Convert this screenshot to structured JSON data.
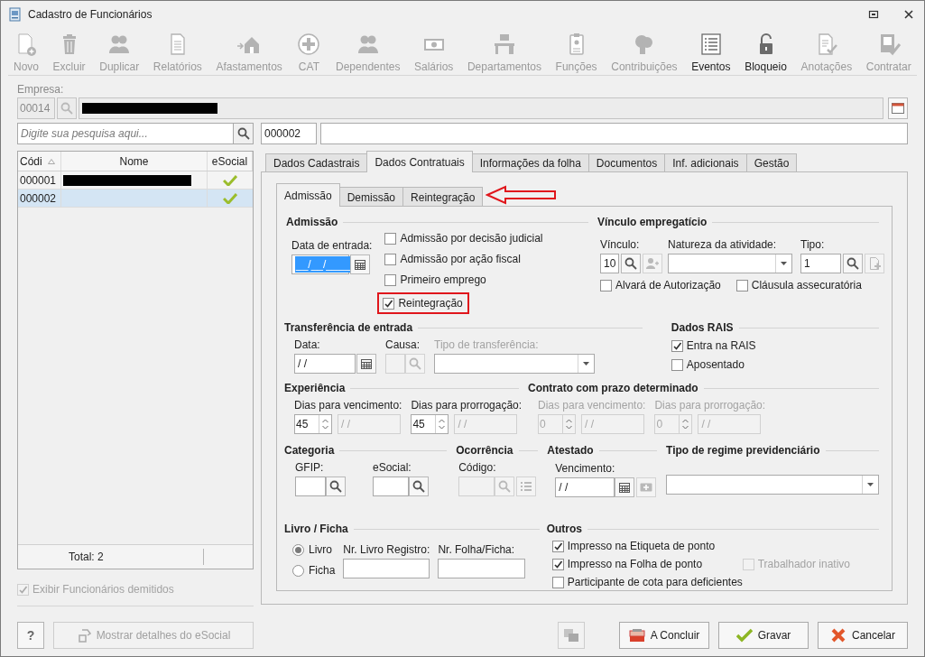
{
  "window": {
    "title": "Cadastro de Funcionários"
  },
  "toolbar": [
    {
      "label": "Novo",
      "enabled": false
    },
    {
      "label": "Excluir",
      "enabled": false
    },
    {
      "label": "Duplicar",
      "enabled": false
    },
    {
      "label": "Relatórios",
      "enabled": false
    },
    {
      "label": "Afastamentos",
      "enabled": false
    },
    {
      "label": "CAT",
      "enabled": false
    },
    {
      "label": "Dependentes",
      "enabled": false
    },
    {
      "label": "Salários",
      "enabled": false
    },
    {
      "label": "Departamentos",
      "enabled": false
    },
    {
      "label": "Funções",
      "enabled": false
    },
    {
      "label": "Contribuições",
      "enabled": false
    },
    {
      "label": "Eventos",
      "enabled": true
    },
    {
      "label": "Bloqueio",
      "enabled": true
    },
    {
      "label": "Anotações",
      "enabled": false
    },
    {
      "label": "Contratar",
      "enabled": false
    }
  ],
  "empresa": {
    "label": "Empresa:",
    "code": "00014"
  },
  "search": {
    "placeholder": "Digite sua pesquisa aqui..."
  },
  "employee_code": "000002",
  "table": {
    "columns": [
      {
        "label": "Códi",
        "sorted": true
      },
      {
        "label": "Nome",
        "sorted": false
      },
      {
        "label": "eSocial",
        "sorted": false
      }
    ],
    "rows": [
      {
        "code": "000001",
        "esocial": true,
        "selected": false
      },
      {
        "code": "000002",
        "esocial": true,
        "selected": true
      }
    ],
    "total": "Total: 2"
  },
  "show_dismissed": {
    "label": "Exibir Funcionários demitidos",
    "checked": true,
    "disabled": true
  },
  "tabs": [
    {
      "label": "Dados Cadastrais",
      "selected": false
    },
    {
      "label": "Dados Contratuais",
      "selected": true
    },
    {
      "label": "Informações da folha",
      "selected": false
    },
    {
      "label": "Documentos",
      "selected": false
    },
    {
      "label": "Inf. adicionais",
      "selected": false
    },
    {
      "label": "Gestão",
      "selected": false
    }
  ],
  "subtabs": [
    {
      "label": "Admissão",
      "selected": true,
      "annotated": false
    },
    {
      "label": "Demissão",
      "selected": false,
      "annotated": false
    },
    {
      "label": "Reintegração",
      "selected": false,
      "annotated": true
    }
  ],
  "admissao": {
    "title": "Admissão",
    "date_label": "Data de entrada:",
    "date_value": "__/__/____",
    "date_selected": true,
    "checkboxes": [
      {
        "label": "Admissão por decisão judicial",
        "checked": false,
        "highlighted": false
      },
      {
        "label": "Admissão por ação fiscal",
        "checked": false,
        "highlighted": false
      },
      {
        "label": "Primeiro emprego",
        "checked": false,
        "highlighted": false
      },
      {
        "label": "Reintegração",
        "checked": true,
        "highlighted": true
      }
    ]
  },
  "vinculo": {
    "title": "Vínculo empregatício",
    "vinculo_label": "Vínculo:",
    "vinculo_value": "10",
    "natureza_label": "Natureza da atividade:",
    "tipo_label": "Tipo:",
    "tipo_value": "1",
    "checkboxes": [
      {
        "label": "Alvará de Autorização",
        "checked": false
      },
      {
        "label": "Cláusula assecuratória",
        "checked": false
      }
    ]
  },
  "transferencia": {
    "title": "Transferência de entrada",
    "data_label": "Data:",
    "data_value": "/ /",
    "causa_label": "Causa:",
    "tipo_label": "Tipo de transferência:",
    "causa_disabled": true
  },
  "rais": {
    "title": "Dados RAIS",
    "checkboxes": [
      {
        "label": "Entra na RAIS",
        "checked": true
      },
      {
        "label": "Aposentado",
        "checked": false
      }
    ]
  },
  "experiencia": {
    "title": "Experiência",
    "disabled": false,
    "fields": [
      {
        "label": "Dias para vencimento:",
        "days": "45",
        "date": "/ /"
      },
      {
        "label": "Dias para prorrogação:",
        "days": "45",
        "date": "/ /"
      }
    ]
  },
  "contrato": {
    "title": "Contrato com prazo determinado",
    "disabled": true,
    "fields": [
      {
        "label": "Dias para vencimento:",
        "days": "0",
        "date": "/ /"
      },
      {
        "label": "Dias para prorrogação:",
        "days": "0",
        "date": "/ /"
      }
    ]
  },
  "categoria": {
    "title": "Categoria",
    "gfip_label": "GFIP:",
    "esocial_label": "eSocial:"
  },
  "ocorrencia": {
    "title": "Ocorrência",
    "codigo_label": "Código:",
    "codigo_disabled": true
  },
  "atestado": {
    "title": "Atestado",
    "vencimento_label": "Vencimento:",
    "vencimento_value": "/ /"
  },
  "regime": {
    "title": "Tipo de regime previdenciário"
  },
  "livro": {
    "title": "Livro / Ficha",
    "options": [
      {
        "label": "Livro",
        "selected": true
      },
      {
        "label": "Ficha",
        "selected": false
      }
    ],
    "registro_label": "Nr. Livro Registro:",
    "folha_label": "Nr. Folha/Ficha:"
  },
  "outros": {
    "title": "Outros",
    "checkboxes": [
      {
        "label": "Impresso na Etiqueta de ponto",
        "checked": true,
        "disabled": false
      },
      {
        "label": "Impresso na Folha de ponto",
        "checked": true,
        "disabled": false
      },
      {
        "label": "Trabalhador inativo",
        "checked": false,
        "disabled": true
      },
      {
        "label": "Participante de cota para deficientes",
        "checked": false,
        "disabled": false
      }
    ]
  },
  "footer": {
    "help": "?",
    "details": {
      "label": "Mostrar detalhes do eSocial",
      "disabled": true
    },
    "buttons": [
      {
        "label": "A Concluir"
      },
      {
        "label": "Gravar"
      },
      {
        "label": "Cancelar"
      }
    ]
  }
}
